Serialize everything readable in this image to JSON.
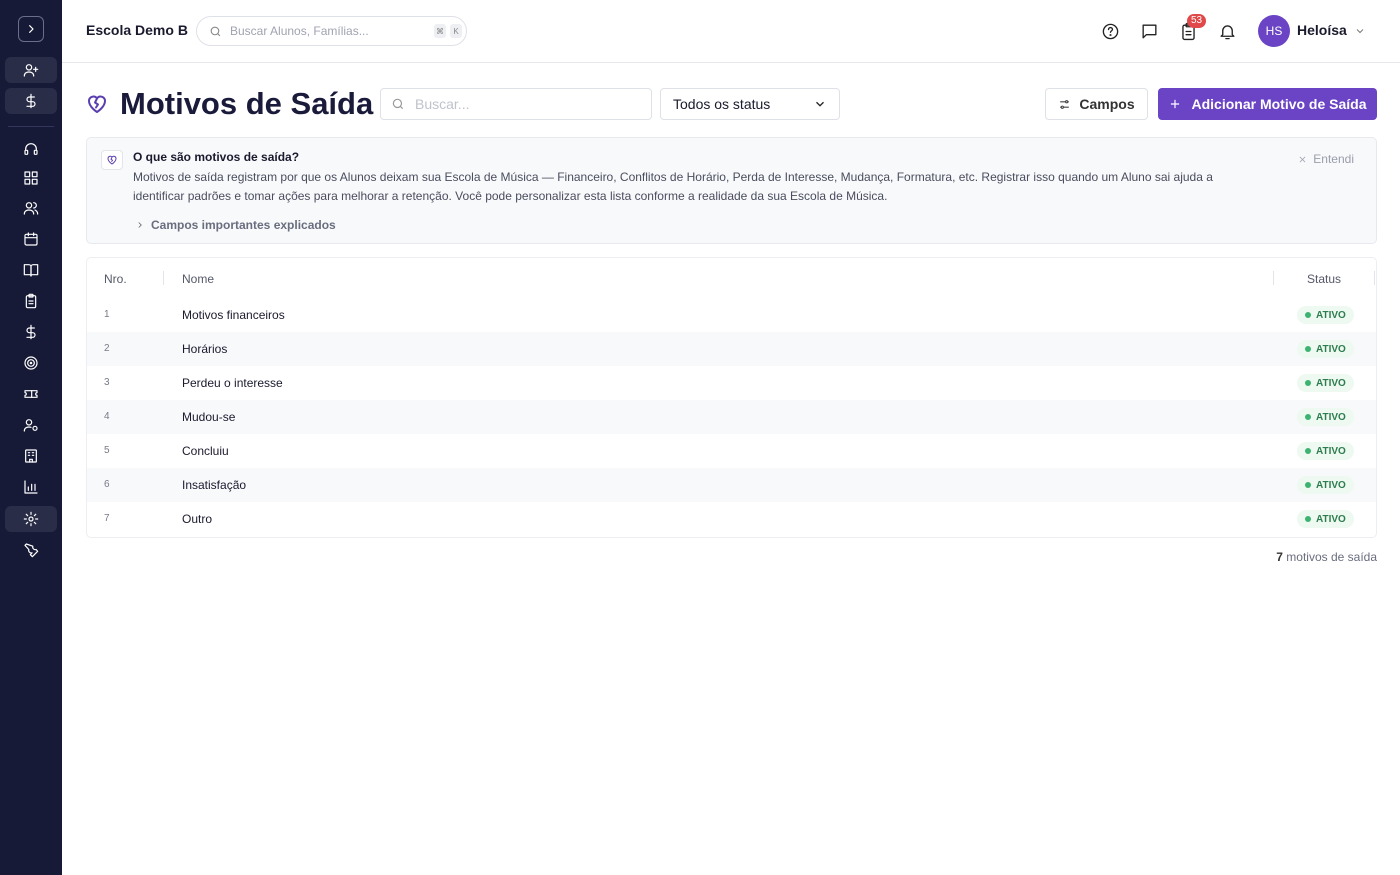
{
  "topbar": {
    "school_name": "Escola Demo B",
    "search_placeholder": "Buscar Alunos, Famílias...",
    "search_kbd_1": "⌘",
    "search_kbd_2": "K",
    "tasks_badge": "53",
    "avatar_initials": "HS",
    "user_name": "Heloísa"
  },
  "page": {
    "title": "Motivos de Saída",
    "search_placeholder": "Buscar...",
    "status_filter": "Todos os status",
    "fields_button": "Campos",
    "add_button": "Adicionar Motivo de Saída"
  },
  "info": {
    "title": "O que são motivos de saída?",
    "body": "Motivos de saída registram por que os Alunos deixam sua Escola de Música — Financeiro, Conflitos de Horário, Perda de Interesse, Mudança, Formatura, etc. Registrar isso quando um Aluno sai ajuda a identificar padrões e tomar ações para melhorar a retenção. Você pode personalizar esta lista conforme a realidade da sua Escola de Música.",
    "expand_label": "Campos importantes explicados",
    "dismiss_label": "Entendi"
  },
  "table": {
    "headers": {
      "nro": "Nro.",
      "nome": "Nome",
      "status": "Status"
    },
    "rows": [
      {
        "nro": "1",
        "nome": "Motivos financeiros",
        "status": "ATIVO"
      },
      {
        "nro": "2",
        "nome": "Horários",
        "status": "ATIVO"
      },
      {
        "nro": "3",
        "nome": "Perdeu o interesse",
        "status": "ATIVO"
      },
      {
        "nro": "4",
        "nome": "Mudou-se",
        "status": "ATIVO"
      },
      {
        "nro": "5",
        "nome": "Concluiu",
        "status": "ATIVO"
      },
      {
        "nro": "6",
        "nome": "Insatisfação",
        "status": "ATIVO"
      },
      {
        "nro": "7",
        "nome": "Outro",
        "status": "ATIVO"
      }
    ]
  },
  "footer": {
    "count": "7",
    "count_label": "motivos de saída"
  },
  "colors": {
    "sidebar": "#171a36",
    "accent": "#6a44c4",
    "active_status": "#2e7d4f"
  }
}
